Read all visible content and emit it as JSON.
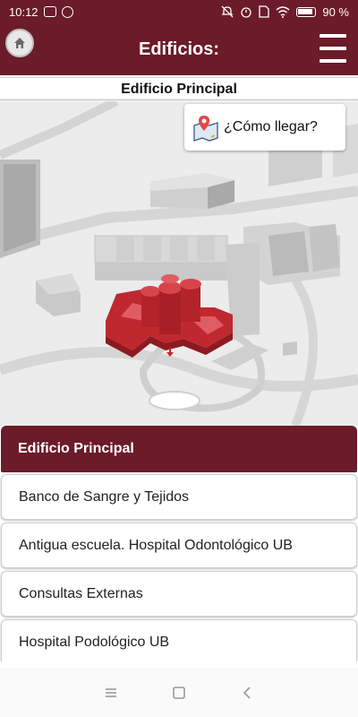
{
  "status_bar": {
    "time": "10:12",
    "battery": "90 %",
    "icons": [
      "message-icon",
      "whatsapp-icon",
      "mute-icon",
      "alarm-icon",
      "sim-icon",
      "wifi-icon",
      "battery-icon"
    ]
  },
  "app_bar": {
    "title": "Edificios:",
    "home_icon": "home-icon",
    "menu_icon": "hamburger-menu-icon"
  },
  "section": {
    "title": "Edificio Principal"
  },
  "map": {
    "directions_label": "¿Cómo llegar?",
    "directions_icon": "map-pin-icon",
    "highlight_color": "#c0282f"
  },
  "buildings": {
    "selected": "Edificio Principal",
    "items": [
      "Banco de Sangre y Tejidos",
      "Antigua escuela. Hospital Odontológico UB",
      "Consultas Externas",
      "Hospital Podológico UB"
    ]
  },
  "theme": {
    "primary": "#6b1b2a"
  },
  "nav_bar": {
    "icons": [
      "recents-icon",
      "home-square-icon",
      "back-icon"
    ]
  }
}
